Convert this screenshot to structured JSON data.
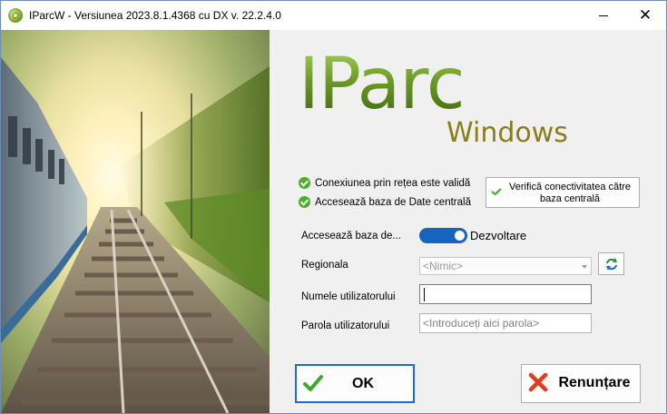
{
  "window": {
    "title": "IParcW - Versiunea 2023.8.1.4368 cu DX v. 22.2.4.0",
    "minimize_symbol": "—",
    "close_symbol": "✕"
  },
  "logo": {
    "main": "IParc",
    "sub": "Windows"
  },
  "status": {
    "network": "Conexiunea prin rețea este validă",
    "database": "Accesează baza de Date centrală"
  },
  "verify_button": {
    "label": "Verifică conectivitatea către baza centrală"
  },
  "form": {
    "access_label": "Accesează baza de...",
    "access_toggle_value": "Dezvoltare",
    "access_toggle_on": true,
    "regional_label": "Regionala",
    "regional_value": "<Nimic>",
    "username_label": "Numele utilizatorului",
    "username_value": "",
    "password_label": "Parola utilizatorului",
    "password_placeholder": "<Introduceți aici parola>"
  },
  "buttons": {
    "ok": "OK",
    "cancel": "Renunțare"
  },
  "colors": {
    "accent": "#1565c0",
    "logo_green": "#6b9a24",
    "logo_gold": "#8a7d1c",
    "ok_check": "#3caa28",
    "cancel_x": "#e23b1e"
  },
  "icons": [
    "app-icon",
    "check-circle-icon",
    "check-icon",
    "refresh-icon",
    "cancel-x-icon"
  ]
}
